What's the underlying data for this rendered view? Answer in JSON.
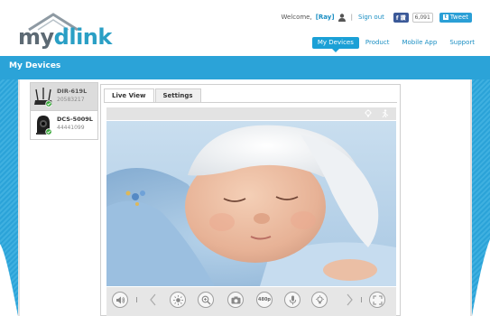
{
  "header": {
    "logo": {
      "part1": "my",
      "part2": "dlin",
      "part3": "k"
    },
    "welcome_prefix": "Welcome,",
    "username": "[Ray]",
    "separator": "|",
    "sign_out": "Sign out",
    "fb_like_label": "f 讚",
    "fb_count": "6,091",
    "tweet_label": "Tweet"
  },
  "nav": {
    "items": [
      {
        "label": "My Devices",
        "active": true
      },
      {
        "label": "Product",
        "active": false
      },
      {
        "label": "Mobile App",
        "active": false
      },
      {
        "label": "Support",
        "active": false
      }
    ]
  },
  "band": {
    "title": "My Devices"
  },
  "devices": [
    {
      "name": "DIR-619L",
      "id": "20583217",
      "selected": true,
      "icon": "router-icon"
    },
    {
      "name": "DCS-5009L",
      "id": "44441099",
      "selected": false,
      "icon": "camera-icon"
    }
  ],
  "viewer": {
    "tabs": [
      {
        "label": "Live View",
        "active": true
      },
      {
        "label": "Settings",
        "active": false
      }
    ],
    "top_icons": [
      "light-bulb-icon",
      "motion-icon"
    ],
    "controls": [
      "speaker-icon",
      "previous-arrow-icon",
      "brightness-icon",
      "zoom-icon",
      "snapshot-icon",
      "resolution-480p-icon",
      "microphone-icon",
      "night-mode-icon",
      "next-arrow-icon",
      "fullscreen-icon"
    ],
    "resolution_label": "480p"
  },
  "colors": {
    "brand_blue": "#2ba3d8",
    "link_blue": "#1b8fc3",
    "facebook": "#3b5998",
    "twitter": "#2a9fd6"
  }
}
